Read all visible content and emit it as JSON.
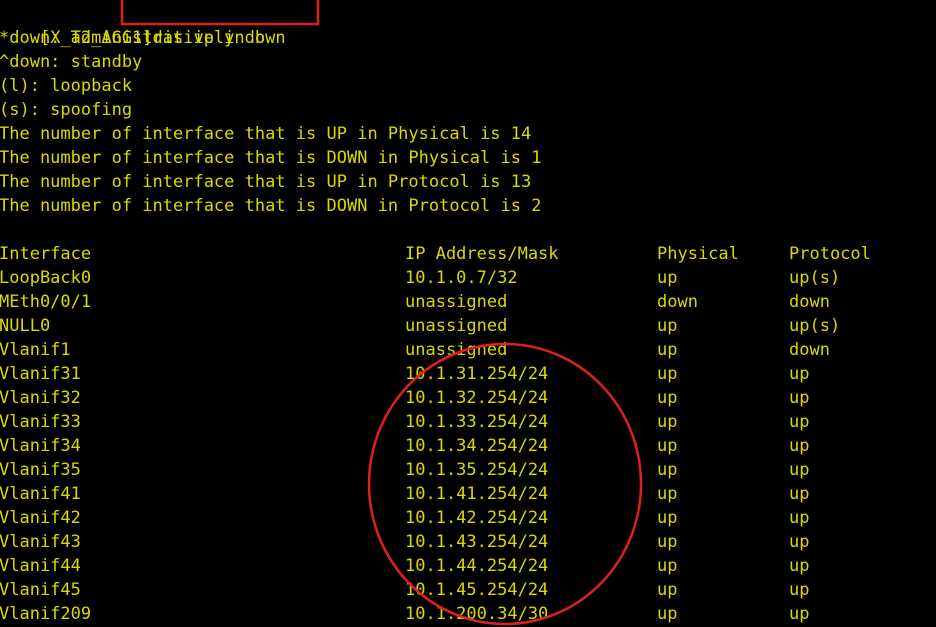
{
  "prompt": {
    "hostname": "[X_T2_AGG1]",
    "command": "dis ip in b"
  },
  "legend": [
    "*down: administratively down",
    "^down: standby",
    "(l): loopback",
    "(s): spoofing"
  ],
  "summary": [
    "The number of interface that is UP in Physical is 14",
    "The number of interface that is DOWN in Physical is 1",
    "The number of interface that is UP in Protocol is 13",
    "The number of interface that is DOWN in Protocol is 2"
  ],
  "table": {
    "headers": {
      "interface": "Interface",
      "ip": "IP Address/Mask",
      "physical": "Physical",
      "protocol": "Protocol"
    },
    "rows": [
      {
        "interface": "LoopBack0",
        "ip": "10.1.0.7/32",
        "physical": "up",
        "protocol": "up(s)"
      },
      {
        "interface": "MEth0/0/1",
        "ip": "unassigned",
        "physical": "down",
        "protocol": "down"
      },
      {
        "interface": "NULL0",
        "ip": "unassigned",
        "physical": "up",
        "protocol": "up(s)"
      },
      {
        "interface": "Vlanif1",
        "ip": "unassigned",
        "physical": "up",
        "protocol": "down"
      },
      {
        "interface": "Vlanif31",
        "ip": "10.1.31.254/24",
        "physical": "up",
        "protocol": "up"
      },
      {
        "interface": "Vlanif32",
        "ip": "10.1.32.254/24",
        "physical": "up",
        "protocol": "up"
      },
      {
        "interface": "Vlanif33",
        "ip": "10.1.33.254/24",
        "physical": "up",
        "protocol": "up"
      },
      {
        "interface": "Vlanif34",
        "ip": "10.1.34.254/24",
        "physical": "up",
        "protocol": "up"
      },
      {
        "interface": "Vlanif35",
        "ip": "10.1.35.254/24",
        "physical": "up",
        "protocol": "up"
      },
      {
        "interface": "Vlanif41",
        "ip": "10.1.41.254/24",
        "physical": "up",
        "protocol": "up"
      },
      {
        "interface": "Vlanif42",
        "ip": "10.1.42.254/24",
        "physical": "up",
        "protocol": "up"
      },
      {
        "interface": "Vlanif43",
        "ip": "10.1.43.254/24",
        "physical": "up",
        "protocol": "up"
      },
      {
        "interface": "Vlanif44",
        "ip": "10.1.44.254/24",
        "physical": "up",
        "protocol": "up"
      },
      {
        "interface": "Vlanif45",
        "ip": "10.1.45.254/24",
        "physical": "up",
        "protocol": "up"
      },
      {
        "interface": "Vlanif209",
        "ip": "10.1.200.34/30",
        "physical": "up",
        "protocol": "up"
      }
    ]
  },
  "colors": {
    "background": "#000000",
    "text": "#d9d900",
    "annotation": "#e0201c"
  }
}
